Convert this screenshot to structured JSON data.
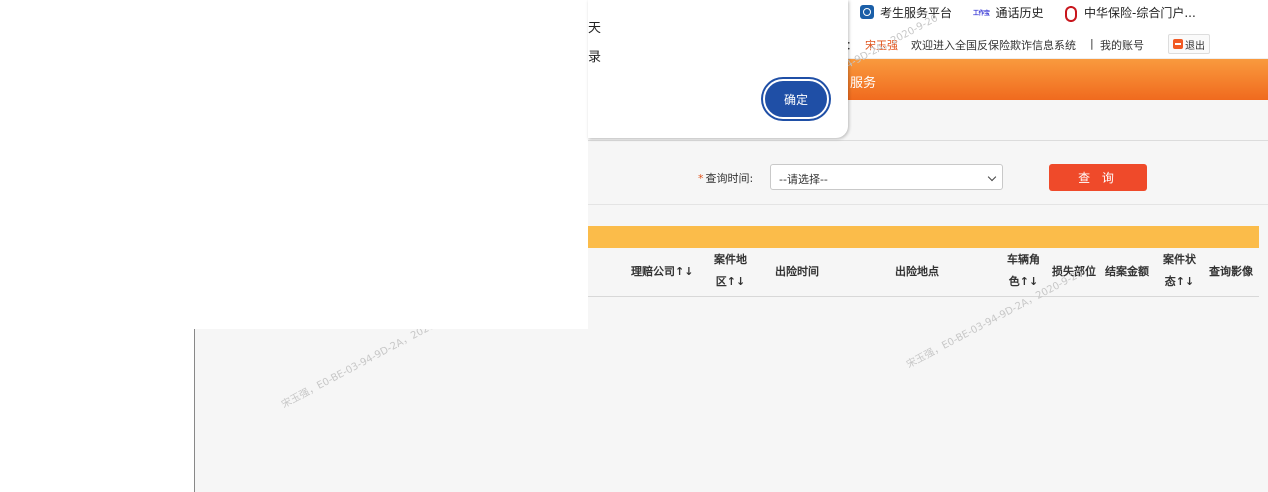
{
  "bookmarks": [
    {
      "label": "考生服务平台",
      "icon": "exam-portal-icon"
    },
    {
      "label": "通话历史",
      "icon": "call-history-icon"
    },
    {
      "label": "中华保险-综合门户...",
      "icon": "zhonghua-logo-icon"
    }
  ],
  "header": {
    "sep": "：",
    "user_name": "宋玉强",
    "welcome": "欢迎进入全国反保险欺诈信息系统",
    "divider": "|",
    "my_account": "我的账号",
    "logout": "退出",
    "nav_partial": "服务"
  },
  "query": {
    "required_mark": "*",
    "time_label": "查询时间:",
    "time_select_value": "--请选择--",
    "search_button": "查 询"
  },
  "table": {
    "columns": [
      {
        "l1": "理赔公司↑↓",
        "l2": ""
      },
      {
        "l1": "案件地",
        "l2": "区↑↓"
      },
      {
        "l1": "出险时间",
        "l2": ""
      },
      {
        "l1": "出险地点",
        "l2": ""
      },
      {
        "l1": "车辆角",
        "l2": "色↑↓"
      },
      {
        "l1": "损失部位",
        "l2": ""
      },
      {
        "l1": "结案金额",
        "l2": ""
      },
      {
        "l1": "案件状",
        "l2": "态↑↓"
      },
      {
        "l1": "查询影像",
        "l2": ""
      }
    ]
  },
  "dialog": {
    "line1": "天",
    "line2": "录",
    "ok_button": "确定"
  },
  "watermark": "宋玉强，E0-BE-03-94-9D-2A，2020-9-20"
}
